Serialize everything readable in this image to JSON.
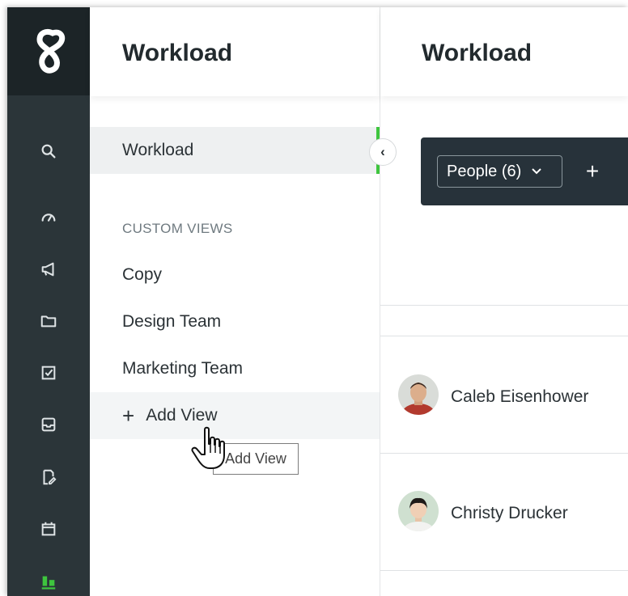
{
  "rail": {
    "icons": [
      "search-icon",
      "dashboard-gauge-icon",
      "megaphone-icon",
      "folder-icon",
      "task-check-icon",
      "inbox-icon",
      "document-edit-icon",
      "calendar-icon",
      "workload-bar-icon"
    ],
    "active_color": "#3ec53e"
  },
  "subnav": {
    "title": "Workload",
    "active_item": "Workload",
    "section_label": "CUSTOM VIEWS",
    "custom_views": [
      "Copy",
      "Design Team",
      "Marketing Team"
    ],
    "add_view_label": "Add View",
    "add_view_plus": "+"
  },
  "collapse": {
    "glyph": "‹"
  },
  "main": {
    "title": "Workload",
    "people_filter": "People (6)",
    "add_glyph": "+",
    "people": [
      {
        "name": "Caleb Eisenhower"
      },
      {
        "name": "Christy Drucker"
      }
    ]
  },
  "tooltip": {
    "text": "Add View"
  }
}
